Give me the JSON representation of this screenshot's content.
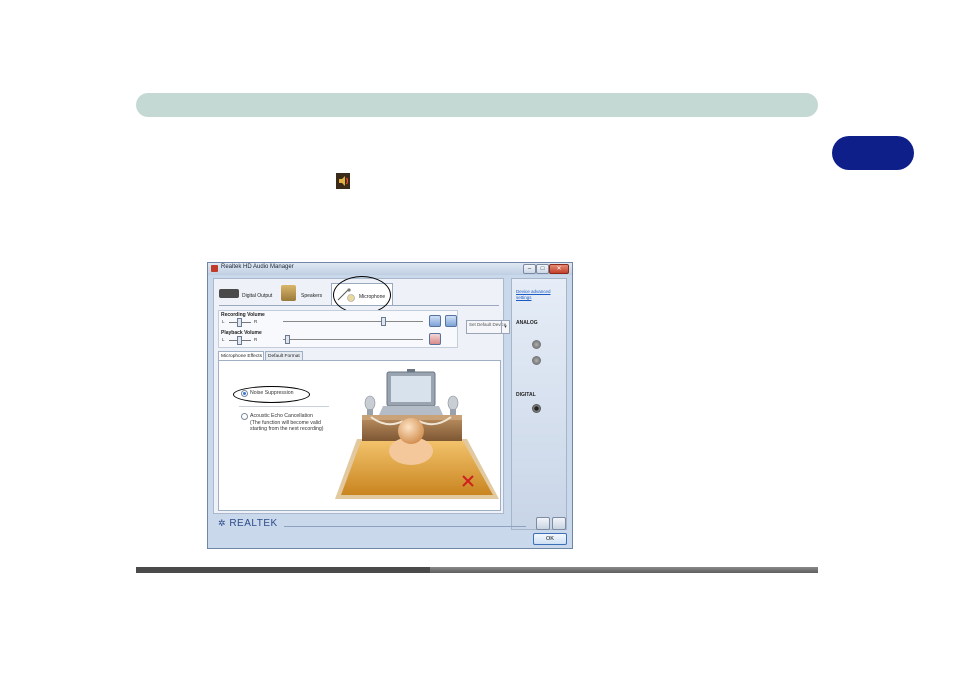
{
  "page": {
    "chapter_tab": "",
    "accent_colors": {
      "header_bar": "#c5d9d4",
      "chapter_tab": "#0e1f8a"
    }
  },
  "icons": {
    "inline_speaker": "speaker-volume-icon"
  },
  "window": {
    "title": "Realtek HD Audio Manager",
    "controls": {
      "minimize": "–",
      "maximize": "□",
      "close": "✕"
    },
    "device_tabs": [
      {
        "label": "Digital Output"
      },
      {
        "label": "Speakers"
      },
      {
        "label": "Microphone"
      }
    ],
    "recording_volume": {
      "label": "Recording Volume",
      "left": "L",
      "right": "R"
    },
    "playback_volume": {
      "label": "Playback Volume",
      "left": "L",
      "right": "R"
    },
    "set_default": "Set Default Device",
    "subtabs": [
      {
        "label": "Microphone Effects"
      },
      {
        "label": "Default Format"
      }
    ],
    "options": {
      "noise_suppression": "Noise Suppression",
      "echo_cancellation": "Acoustic Echo Cancellation",
      "echo_note": "(The function will become valid starting from the next recording)"
    },
    "right_panel": {
      "advanced_link": "Device advanced settings",
      "analog": "ANALOG",
      "digital": "DIGITAL"
    },
    "brand": "REALTEK",
    "ok": "OK"
  }
}
